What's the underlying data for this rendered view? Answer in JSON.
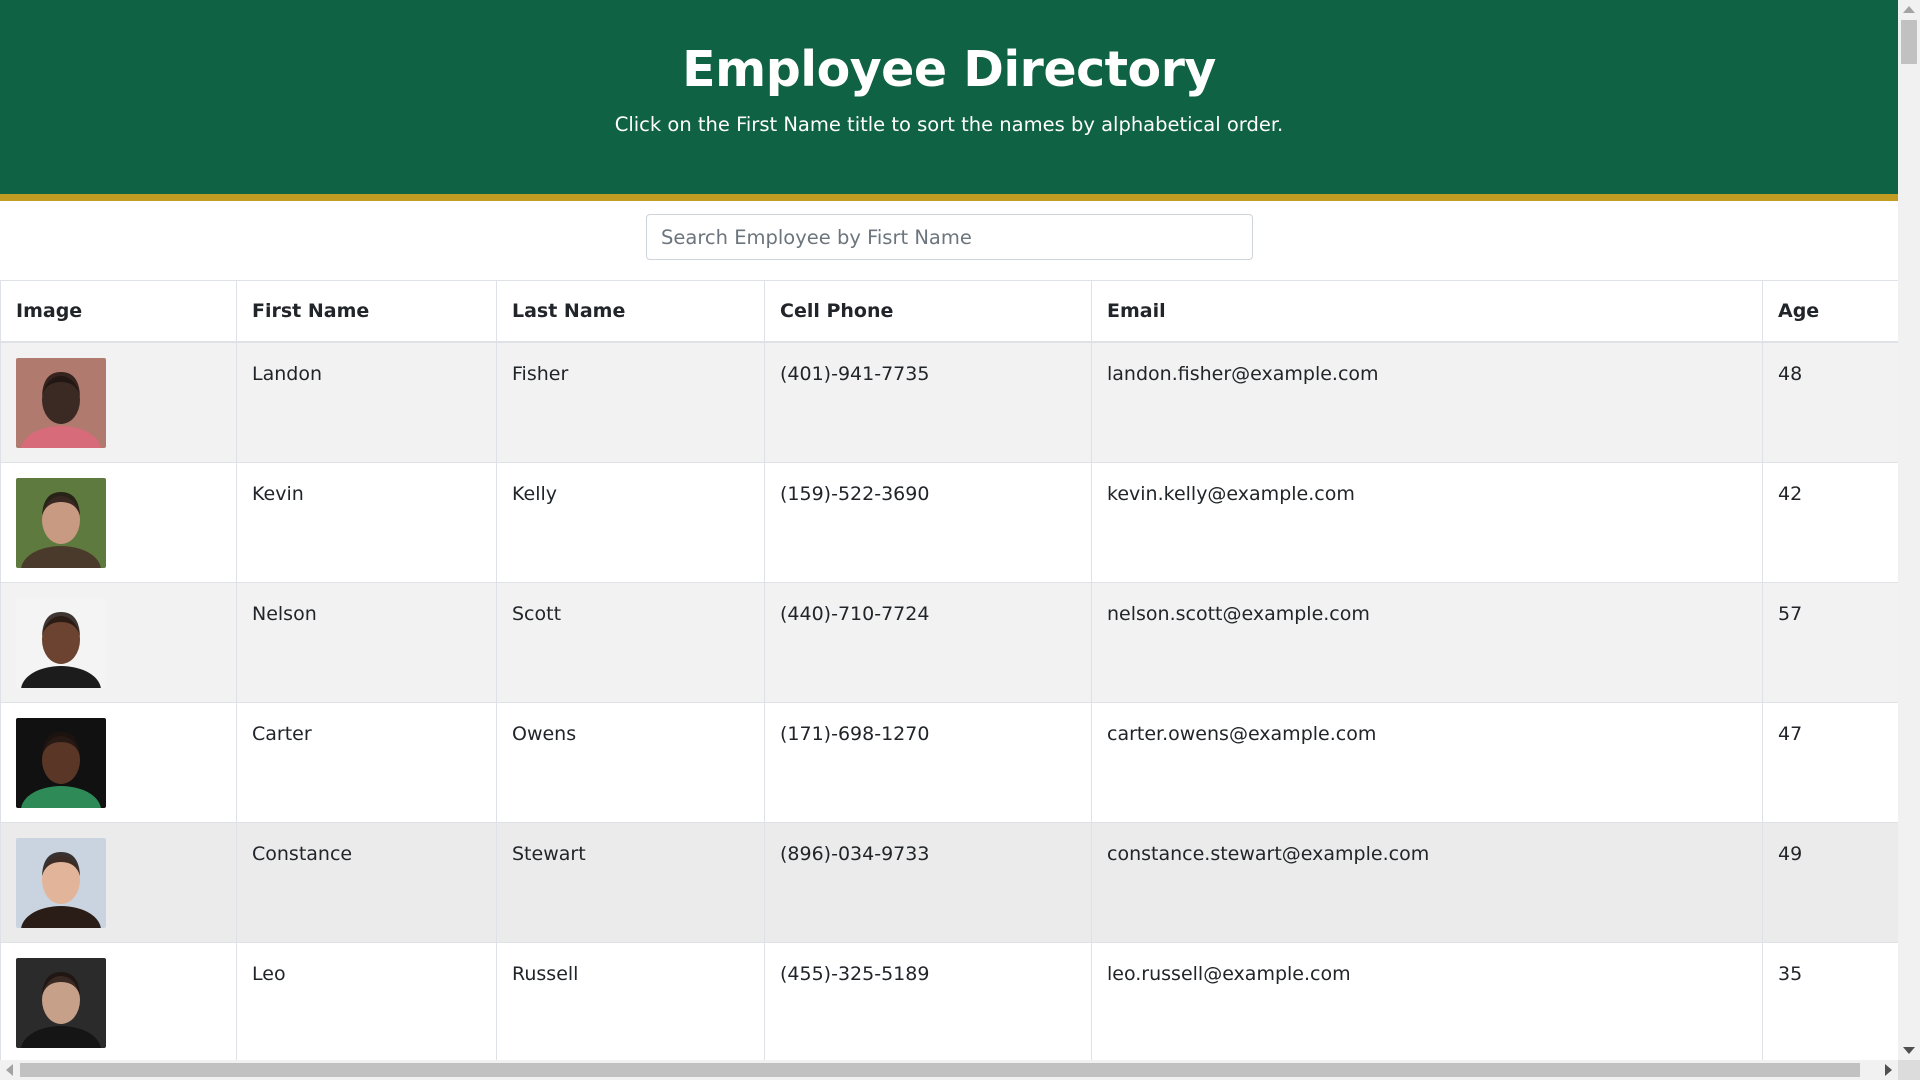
{
  "header": {
    "title": "Employee Directory",
    "subtitle": "Click on the First Name title to sort the names by alphabetical order.",
    "background_color": "#0f6243",
    "accent_border_color": "#c19b22"
  },
  "search": {
    "placeholder": "Search Employee by Fisrt Name",
    "value": ""
  },
  "table": {
    "columns": [
      "Image",
      "First Name",
      "Last Name",
      "Cell Phone",
      "Email",
      "Age"
    ],
    "rows": [
      {
        "first": "Landon",
        "last": "Fisher",
        "phone": "(401)-941-7735",
        "email": "landon.fisher@example.com",
        "age": "48",
        "photo_colors": [
          "#b07a6e",
          "#3b2a24",
          "#d86b7a"
        ]
      },
      {
        "first": "Kevin",
        "last": "Kelly",
        "phone": "(159)-522-3690",
        "email": "kevin.kelly@example.com",
        "age": "42",
        "photo_colors": [
          "#5e7a3e",
          "#c89a82",
          "#4a3a2c"
        ]
      },
      {
        "first": "Nelson",
        "last": "Scott",
        "phone": "(440)-710-7724",
        "email": "nelson.scott@example.com",
        "age": "57",
        "photo_colors": [
          "#f4f4f4",
          "#6b4330",
          "#1c1c1c"
        ]
      },
      {
        "first": "Carter",
        "last": "Owens",
        "phone": "(171)-698-1270",
        "email": "carter.owens@example.com",
        "age": "47",
        "photo_colors": [
          "#111111",
          "#5a3626",
          "#2e8b57"
        ]
      },
      {
        "first": "Constance",
        "last": "Stewart",
        "phone": "(896)-034-9733",
        "email": "constance.stewart@example.com",
        "age": "49",
        "photo_colors": [
          "#c9d4e0",
          "#e2b49a",
          "#2a1d18"
        ]
      },
      {
        "first": "Leo",
        "last": "Russell",
        "phone": "(455)-325-5189",
        "email": "leo.russell@example.com",
        "age": "35",
        "photo_colors": [
          "#2b2b2b",
          "#c7a08a",
          "#151515"
        ]
      }
    ]
  }
}
